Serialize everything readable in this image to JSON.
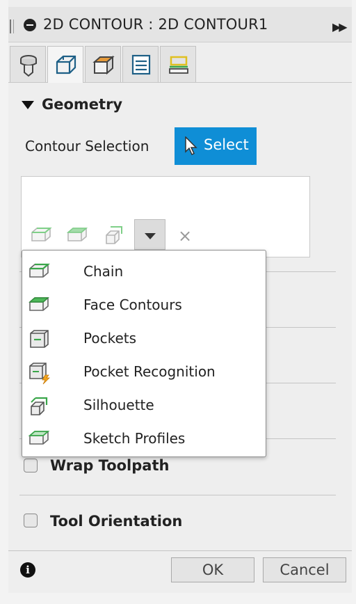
{
  "window": {
    "title": "2D CONTOUR : 2D CONTOUR1"
  },
  "tabs": [
    {
      "name": "tool",
      "icon": "tool-icon",
      "active": false
    },
    {
      "name": "geometry",
      "icon": "geometry-cube-icon",
      "active": true
    },
    {
      "name": "heights",
      "icon": "heights-cube-icon",
      "active": false
    },
    {
      "name": "passes",
      "icon": "passes-icon",
      "active": false
    },
    {
      "name": "linking",
      "icon": "linking-icon",
      "active": false
    }
  ],
  "geometry": {
    "section_title": "Geometry",
    "contour_label": "Contour Selection",
    "select_button": "Select"
  },
  "selection_box": {
    "icons": [
      "chain-icon",
      "face-contours-icon",
      "silhouette-icon"
    ],
    "clear_symbol": "×"
  },
  "dropdown_menu": {
    "items": [
      {
        "label": "Chain",
        "icon": "chain-icon"
      },
      {
        "label": "Face Contours",
        "icon": "face-contours-icon"
      },
      {
        "label": "Pockets",
        "icon": "pockets-icon"
      },
      {
        "label": "Pocket Recognition",
        "icon": "pocket-recognition-icon"
      },
      {
        "label": "Silhouette",
        "icon": "silhouette-icon"
      },
      {
        "label": "Sketch Profiles",
        "icon": "sketch-profiles-icon"
      }
    ]
  },
  "options": {
    "wrap_toolpath": {
      "label": "Wrap Toolpath",
      "checked": false
    },
    "tool_orientation": {
      "label": "Tool Orientation",
      "checked": false
    }
  },
  "footer": {
    "info_symbol": "i",
    "ok_label": "OK",
    "cancel_label": "Cancel"
  },
  "colors": {
    "accent": "#0f8ed6",
    "icon_green": "#3aa64a",
    "icon_orange": "#e08a1e"
  }
}
